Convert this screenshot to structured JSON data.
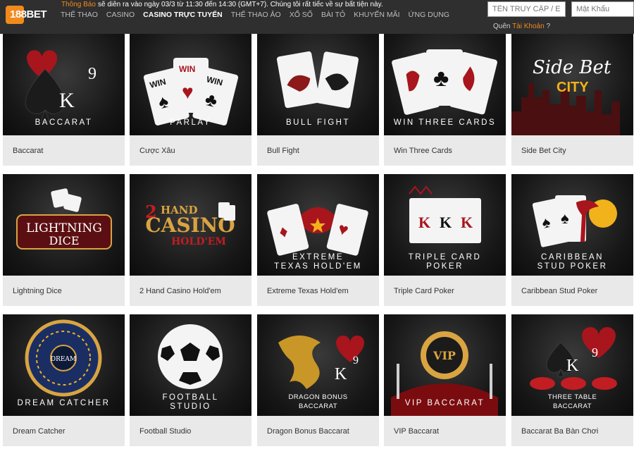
{
  "brand": {
    "logo_text": "188BET"
  },
  "notice": {
    "label": "Thông Báo",
    "text": "sẽ diễn ra vào ngày 03/3 từ 11:30 đến 14:30 (GMT+7). Chúng tôi rất tiếc về sự bất tiện này."
  },
  "nav": {
    "items": [
      "THỂ THAO",
      "CASINO",
      "CASINO TRỰC TUYẾN",
      "THỂ THAO ẢO",
      "XỔ SỐ",
      "BÀI TỎ",
      "KHUYẾN MÃI",
      "ỨNG DỤNG"
    ],
    "active_index": 2
  },
  "login": {
    "username_placeholder": "TÊN TRUY CẬP / EMAIL",
    "password_placeholder": "Mật Khẩu",
    "forgot_prefix": "Quên",
    "forgot_link": "Tài Khoản",
    "forgot_suffix": "?"
  },
  "colors": {
    "accent": "#f18a1d",
    "topbar": "#2f2f2f",
    "card_bg": "#e9e9e9",
    "card_red": "#a8151c"
  },
  "games": [
    {
      "thumb_title": [
        "BACCARAT"
      ],
      "name": "Baccarat",
      "icon": "k9-spade-heart-icon"
    },
    {
      "thumb_title": [
        "PARLAY"
      ],
      "name": "Cược Xâu",
      "icon": "win-cards-icon"
    },
    {
      "thumb_title": [
        "BULL FIGHT"
      ],
      "name": "Bull Fight",
      "icon": "bull-cards-icon"
    },
    {
      "thumb_title": [
        "WIN THREE CARDS"
      ],
      "name": "Win Three Cards",
      "icon": "three-cards-icon"
    },
    {
      "thumb_title": [
        "Side Bet",
        "CITY"
      ],
      "name": "Side Bet City",
      "icon": "city-skyline-icon"
    },
    {
      "thumb_title": [
        "LIGHTNING",
        "DICE"
      ],
      "name": "Lightning Dice",
      "icon": "dice-icon"
    },
    {
      "thumb_title": [
        "2 HAND",
        "CASINO",
        "HOLD'EM"
      ],
      "name": "2 Hand Casino Hold'em",
      "icon": "holdem-logo-icon"
    },
    {
      "thumb_title": [
        "EXTREME",
        "TEXAS HOLD'EM"
      ],
      "name": "Extreme Texas Hold'em",
      "icon": "cowboy-hat-icon"
    },
    {
      "thumb_title": [
        "TRIPLE CARD",
        "POKER"
      ],
      "name": "Triple Card Poker",
      "icon": "king-cards-icon"
    },
    {
      "thumb_title": [
        "CARIBBEAN",
        "STUD POKER"
      ],
      "name": "Caribbean Stud Poker",
      "icon": "palm-cards-icon"
    },
    {
      "thumb_title": [
        "DREAM CATCHER"
      ],
      "name": "Dream Catcher",
      "icon": "money-wheel-icon"
    },
    {
      "thumb_title": [
        "FOOTBALL",
        "STUDIO"
      ],
      "name": "Football Studio",
      "icon": "football-icon"
    },
    {
      "thumb_title": [
        "DRAGON BONUS",
        "BACCARAT"
      ],
      "name": "Dragon Bonus Baccarat",
      "icon": "dragon-icon"
    },
    {
      "thumb_title": [
        "VIP BACCARAT"
      ],
      "name": "VIP Baccarat",
      "icon": "vip-chip-icon"
    },
    {
      "thumb_title": [
        "THREE TABLE",
        "BACCARAT"
      ],
      "name": "Baccarat Ba Bàn Chơi",
      "icon": "three-tables-icon"
    }
  ]
}
